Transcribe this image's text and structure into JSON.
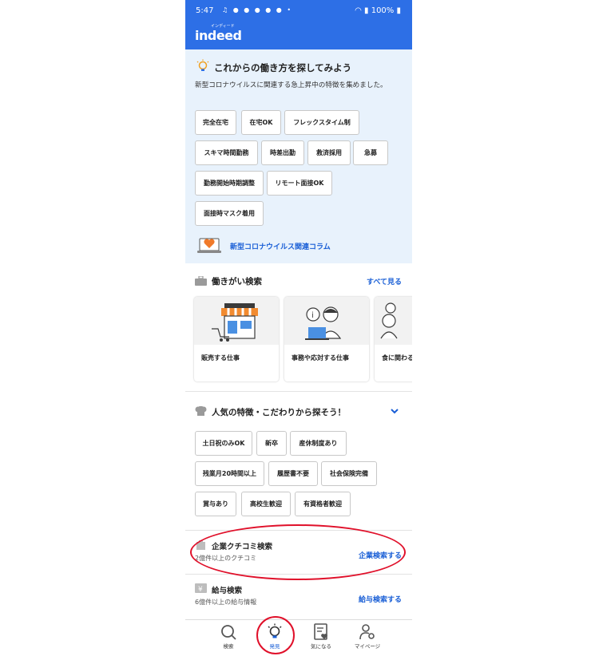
{
  "status_bar": {
    "time": "5:47",
    "notifications": "♫ ● ● ● ● ● •",
    "battery": "100%"
  },
  "app": {
    "logo": "indeed",
    "logo_kana": "インディード"
  },
  "promo": {
    "title": "これからの働き方を探してみよう",
    "description": "新型コロナウイルスに関連する急上昇中の特徴を集めました。",
    "chips": [
      "完全在宅",
      "在宅OK",
      "フレックスタイム制",
      "スキマ時間勤務",
      "時差出勤",
      "救済採用",
      "急募",
      "勤務開始時期調整",
      "リモート面接OK",
      "面接時マスク着用"
    ],
    "link": "新型コロナウイルス関連コラム"
  },
  "work_search": {
    "title": "働きがい検索",
    "see_all": "すべて見る",
    "cards": [
      "販売する仕事",
      "事務や応対する仕事",
      "食に関わる"
    ]
  },
  "features": {
    "title": "人気の特徴・こだわりから探そう！",
    "chips": [
      "土日祝のみOK",
      "新卒",
      "産休制度あり",
      "残業月20時間以上",
      "履歴書不要",
      "社会保険完備",
      "賞与あり",
      "高校生歓迎",
      "有資格者歓迎"
    ]
  },
  "company_reviews": {
    "title": "企業クチコミ検索",
    "subtitle": "2億件以上のクチコミ",
    "action": "企業検索する"
  },
  "salary": {
    "title": "給与検索",
    "subtitle": "6億件以上の給与情報",
    "action": "給与検索する"
  },
  "bottom_nav": [
    {
      "label": "検索",
      "icon": "search-icon"
    },
    {
      "label": "発見",
      "icon": "lightbulb-icon",
      "active": true
    },
    {
      "label": "気になる",
      "icon": "saved-jobs-icon"
    },
    {
      "label": "マイページ",
      "icon": "profile-settings-icon"
    }
  ],
  "colors": {
    "brand_blue": "#2d6fe6",
    "link_blue": "#1a5fd6",
    "promo_bg": "#e8f2fc",
    "annotation_red": "#e0102a"
  }
}
